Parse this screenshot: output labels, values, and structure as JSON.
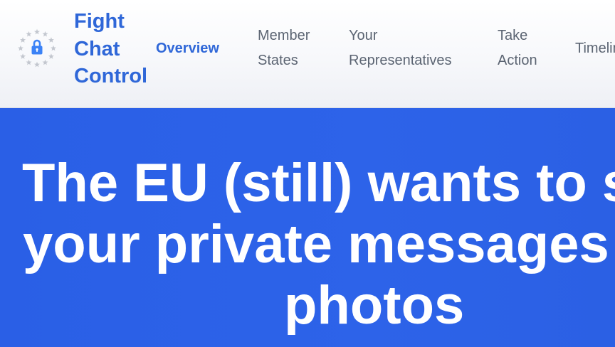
{
  "header": {
    "brand_lines": [
      "Fight",
      "Chat",
      "Control"
    ],
    "logo_icon": "eu-stars-lock-icon",
    "nav": {
      "overview": [
        "Overview"
      ],
      "member_states": [
        "Member",
        "States"
      ],
      "your_representatives": [
        "Your",
        "Representatives"
      ],
      "take_action": [
        "Take",
        "Action"
      ],
      "timeline": [
        "Timeline"
      ]
    }
  },
  "hero": {
    "title_lines": [
      "The EU (still) wants to scan",
      "your private messages and",
      "photos"
    ]
  },
  "colors": {
    "brand": "#2f67d8",
    "hero_background": "#2d63e9",
    "nav_text": "#5b6472",
    "star_gray": "#c3c7cf"
  }
}
